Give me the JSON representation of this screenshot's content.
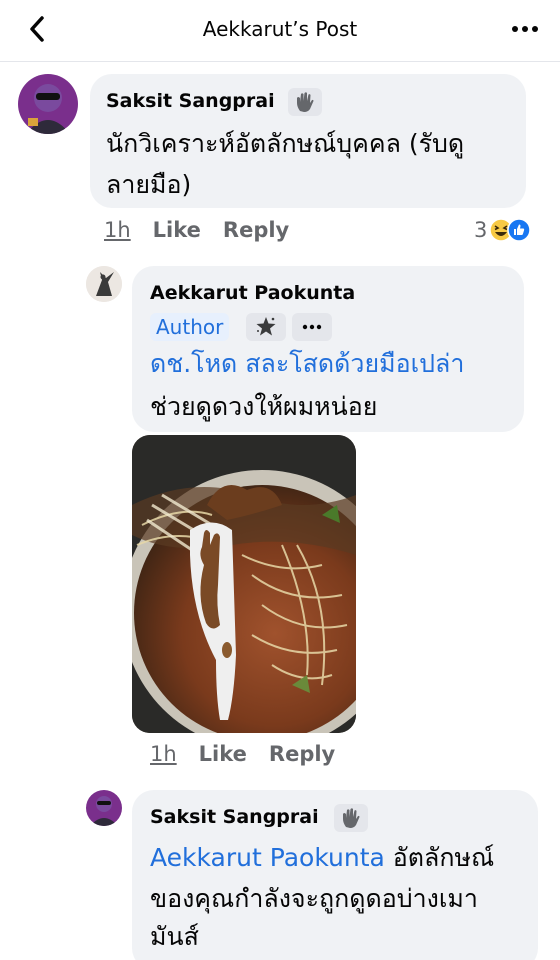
{
  "header": {
    "title": "Aekkarut’s Post",
    "back_icon": "chevron-left-icon",
    "more_icon": "ellipsis-icon"
  },
  "comments": [
    {
      "author": "Saksit Sangprai",
      "badge_icon": "wave-hand-icon",
      "text_lines": [
        "นักวิเคราะห์อัตลักษณ์บุคคล (รับดู",
        "ลายมือ)"
      ],
      "time": "1h",
      "like": "Like",
      "reply": "Reply",
      "reaction_count": "3",
      "reaction_icons": [
        "haha-icon",
        "like-icon"
      ]
    },
    {
      "author": "Aekkarut Paokunta",
      "author_label": "Author",
      "badge_icon": "star-badge-icon",
      "more_icon": "ellipsis-icon",
      "mention": "ดช.โหด สละโสดด้วยมือเปล่า",
      "text": "ช่วยดูดวงให้ผมหน่อย",
      "image": "noodle-soup-photo",
      "time": "1h",
      "like": "Like",
      "reply": "Reply"
    },
    {
      "author": "Saksit Sangprai",
      "badge_icon": "wave-hand-icon",
      "mention": "Aekkarut Paokunta",
      "text_first": "อัตลักษณ์",
      "text_lines": [
        "ของคุณกำลังจะถูกดูดอบ่างเมา",
        "มันส์"
      ]
    }
  ],
  "colors": {
    "link": "#216fdb",
    "bubble": "#f0f2f5",
    "meta": "#65676b"
  }
}
